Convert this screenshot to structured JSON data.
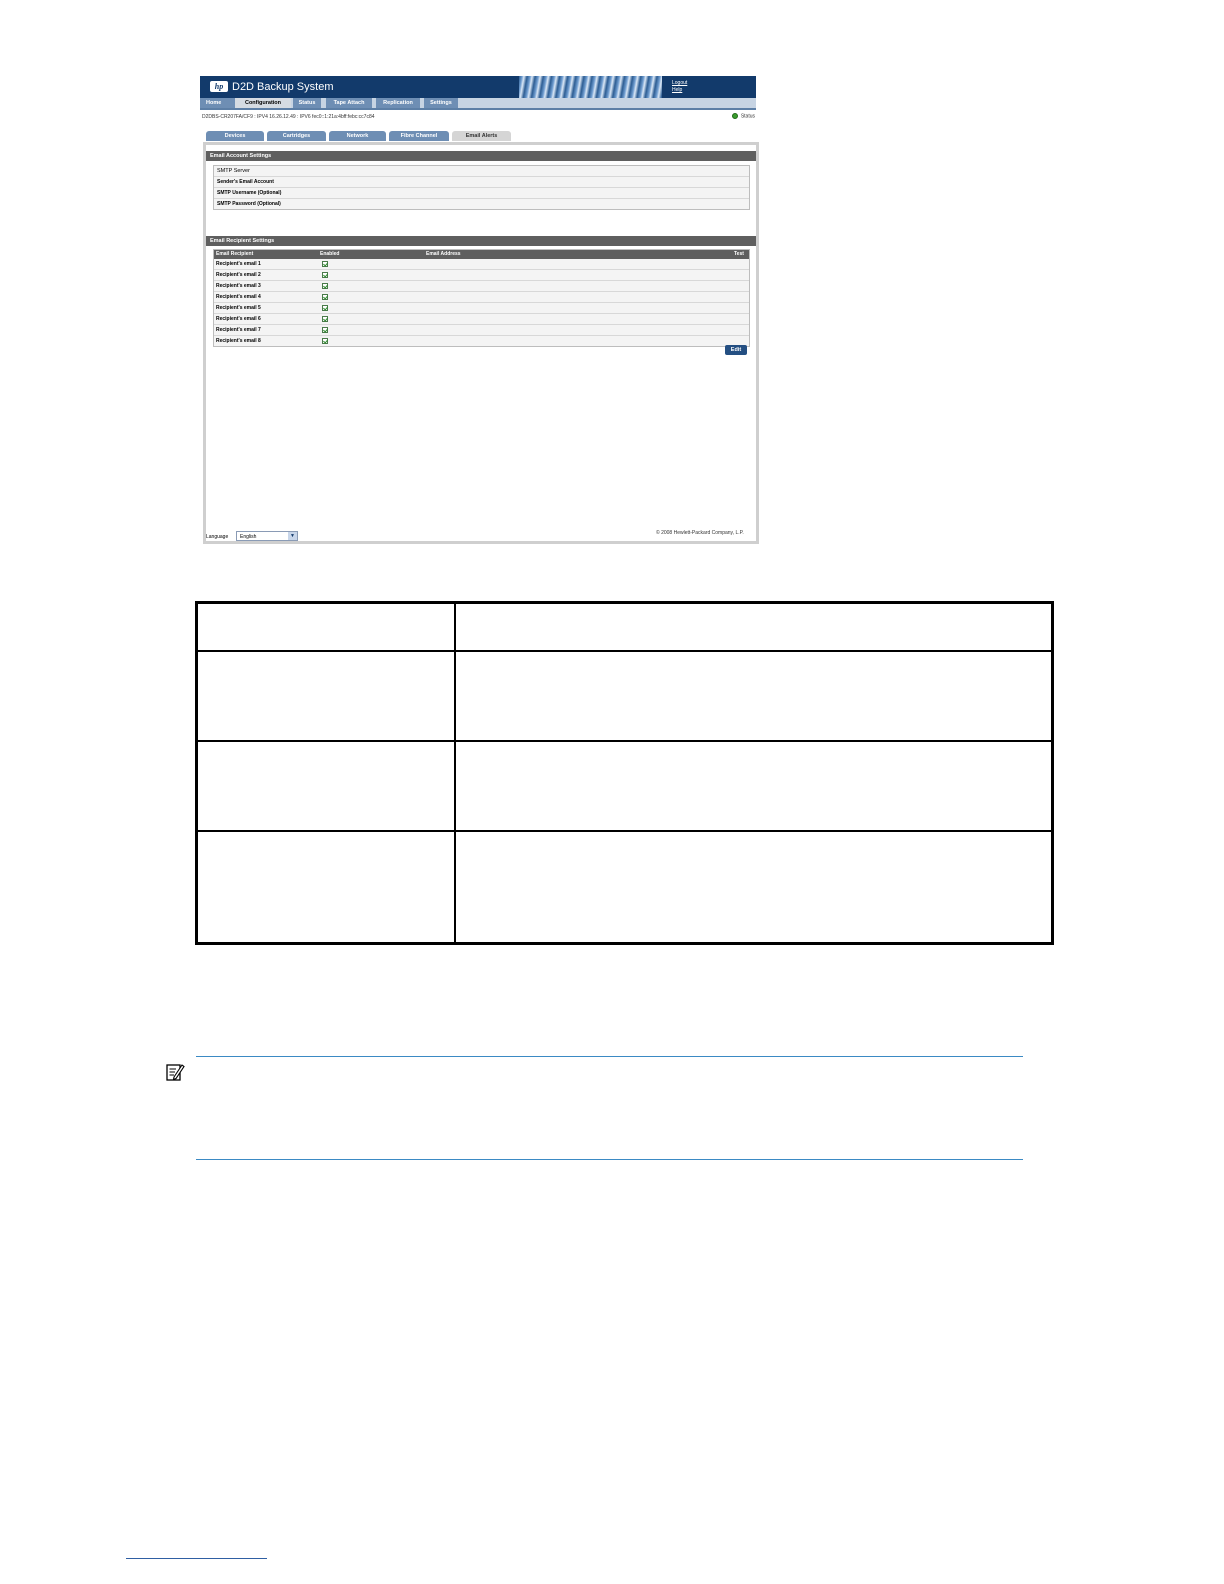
{
  "app": {
    "title": "D2D Backup System",
    "logo_text": "hp",
    "header_links": [
      "Logout",
      "Help"
    ],
    "nav": [
      "Home",
      "Configuration",
      "Status",
      "Tape Attach",
      "Replication",
      "Settings"
    ],
    "nav_active": "Configuration",
    "device_info": "D2DBS-CR207FA/CF9 : IPV4 16.26.12.49 : IPV6 fec0::1:21a:4bff:febc:cc7c84",
    "status_label": "Status",
    "tabs": [
      "Devices",
      "Cartridges",
      "Network",
      "Fibre Channel",
      "Email Alerts"
    ],
    "tab_active": "Email Alerts",
    "account_section": {
      "title": "Email Account Settings",
      "fields": [
        "SMTP Server",
        "Sender's Email Account",
        "SMTP Username (Optional)",
        "SMTP Password (Optional)"
      ]
    },
    "recipient_section": {
      "title": "Email Recipient Settings",
      "columns": [
        "Email Recipient",
        "Enabled",
        "Email Address",
        "Test"
      ],
      "rows": [
        {
          "label": "Recipient's email 1",
          "enabled": true
        },
        {
          "label": "Recipient's email 2",
          "enabled": true
        },
        {
          "label": "Recipient's email 3",
          "enabled": true
        },
        {
          "label": "Recipient's email 4",
          "enabled": true
        },
        {
          "label": "Recipient's email 5",
          "enabled": true
        },
        {
          "label": "Recipient's email 6",
          "enabled": true
        },
        {
          "label": "Recipient's email 7",
          "enabled": true
        },
        {
          "label": "Recipient's email 8",
          "enabled": true
        }
      ]
    },
    "edit_label": "Edit",
    "language_label": "Language",
    "language_value": "English",
    "copyright": "© 2008 Hewlett-Packard Company, L.P."
  },
  "colors": {
    "header_bg": "#123a6b",
    "nav_item": "#6e8eb4",
    "section_bar": "#5f5f5f",
    "note_rule": "#3b8ac4"
  },
  "icons": [
    "hp-logo-icon",
    "status-ok-icon",
    "dropdown-arrow-icon",
    "checkbox-checked-icon",
    "note-icon"
  ]
}
